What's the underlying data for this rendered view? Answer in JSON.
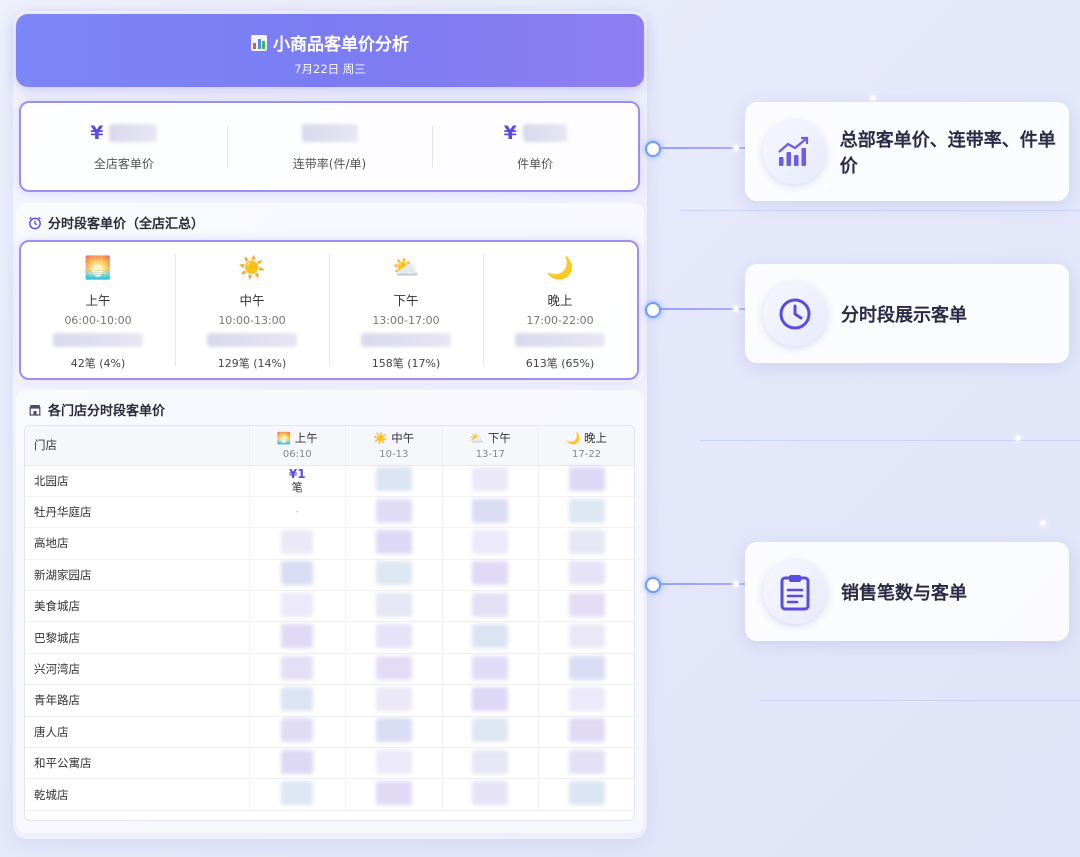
{
  "header": {
    "title": "小商品客单价分析",
    "date": "7月22日 周三"
  },
  "kpis": [
    {
      "prefix": "¥",
      "label": "全店客单价"
    },
    {
      "prefix": "",
      "label": "连带率(件/单)"
    },
    {
      "prefix": "¥",
      "label": "件单价"
    }
  ],
  "time_section": {
    "title": "分时段客单价（全店汇总）",
    "slots": [
      {
        "emoji": "🌅",
        "name": "上午",
        "range": "06:00-10:00",
        "count": "42笔 (4%)"
      },
      {
        "emoji": "☀️",
        "name": "中午",
        "range": "10:00-13:00",
        "count": "129笔 (14%)"
      },
      {
        "emoji": "⛅",
        "name": "下午",
        "range": "13:00-17:00",
        "count": "158笔 (17%)"
      },
      {
        "emoji": "🌙",
        "name": "晚上",
        "range": "17:00-22:00",
        "count": "613笔 (65%)"
      }
    ]
  },
  "store_section": {
    "title": "各门店分时段客单价",
    "store_col": "门店",
    "columns": [
      {
        "emoji": "🌅",
        "name": "上午",
        "range": "06:10"
      },
      {
        "emoji": "☀️",
        "name": "中午",
        "range": "10-13"
      },
      {
        "emoji": "⛅",
        "name": "下午",
        "range": "13-17"
      },
      {
        "emoji": "🌙",
        "name": "晚上",
        "range": "17-22"
      }
    ],
    "first_cell": {
      "value": "¥1",
      "unit": "笔",
      "dash": "-"
    },
    "stores": [
      "北园店",
      "牡丹华庭店",
      "高地店",
      "新湖家园店",
      "美食城店",
      "巴黎城店",
      "兴河湾店",
      "青年路店",
      "唐人店",
      "和平公寓店",
      "乾城店"
    ]
  },
  "features": [
    {
      "icon": "chart-up-icon",
      "text": "总部客单价、连带率、件单价"
    },
    {
      "icon": "clock-icon",
      "text": "分时段展示客单"
    },
    {
      "icon": "clipboard-icon",
      "text": "销售笔数与客单"
    }
  ],
  "colors": {
    "accent": "#7b7cf3",
    "border": "#9d8ff0",
    "value": "#5b4be0"
  }
}
